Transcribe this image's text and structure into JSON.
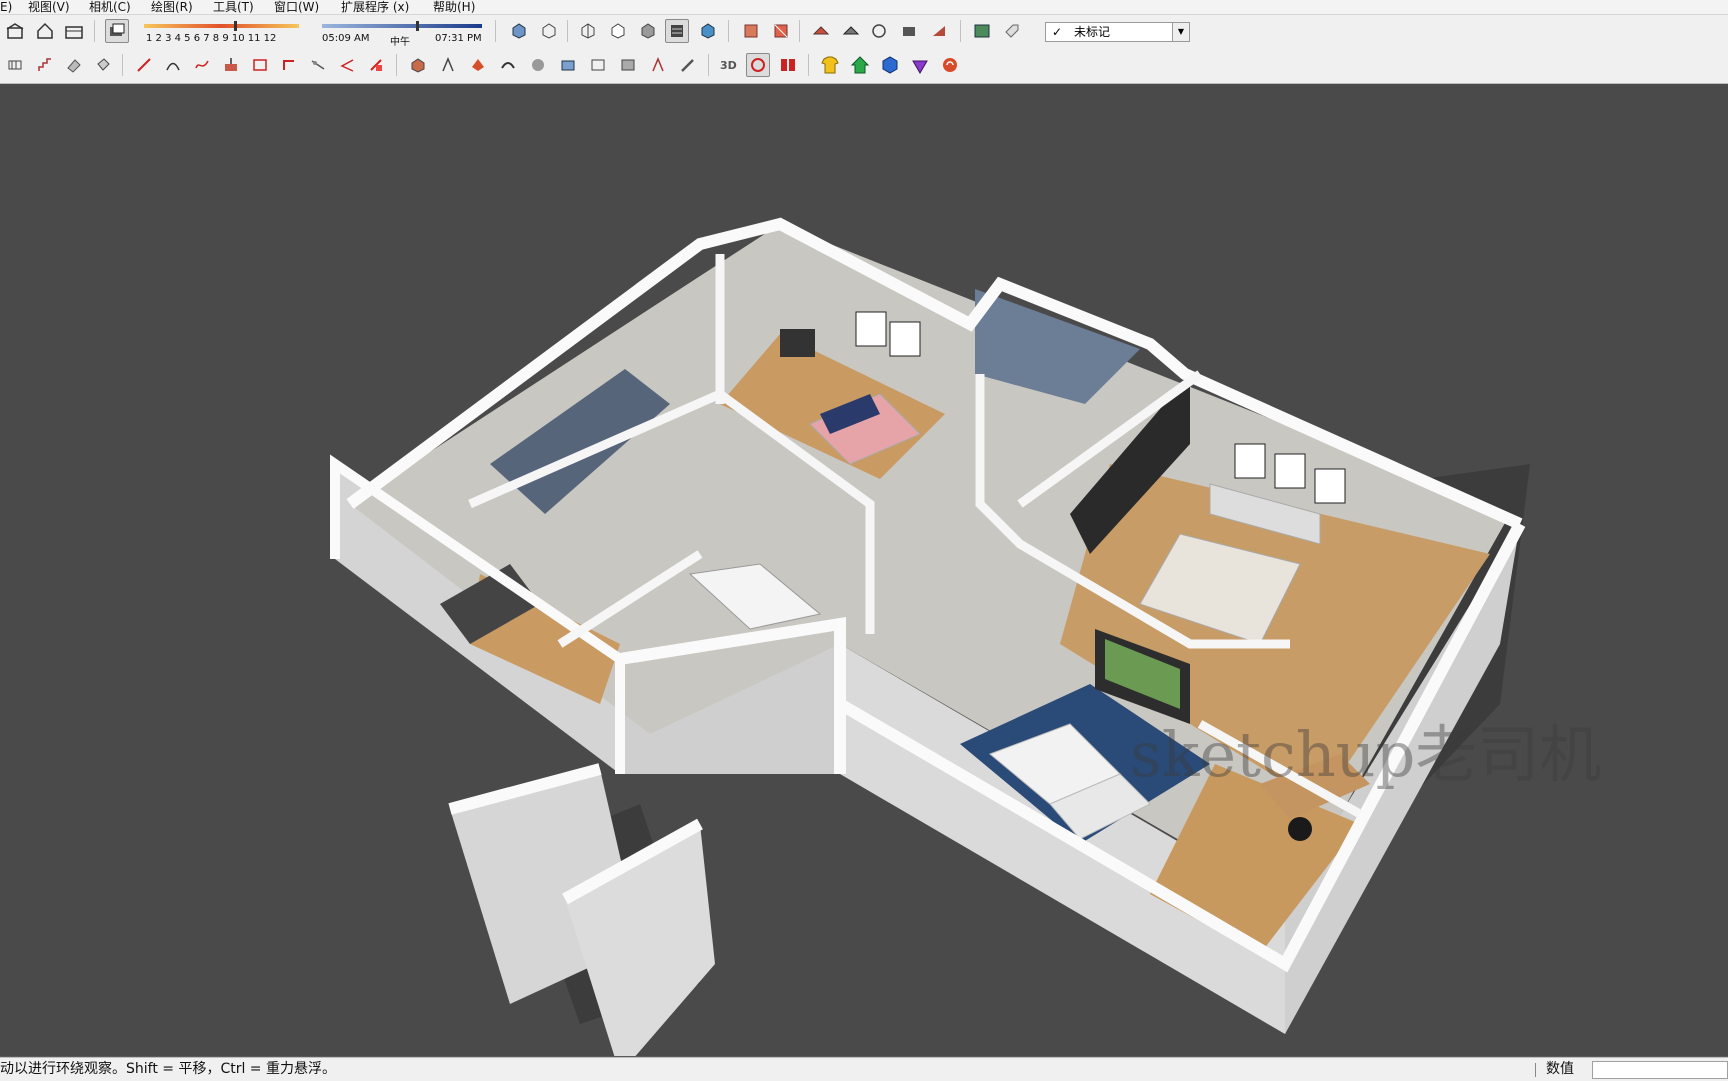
{
  "menu": [
    "E)",
    "视图(V)",
    "相机(C)",
    "绘图(R)",
    "工具(T)",
    "窗口(W)",
    "扩展程序 (x)",
    "帮助(H)"
  ],
  "shadow": {
    "months": "1 2 3 4 5 6 7 8 9 10 11 12",
    "sunrise": "05:09 AM",
    "noon": "中午",
    "sunset": "07:31 PM"
  },
  "layer": {
    "check": "✓",
    "name": "未标记"
  },
  "watermark": "sketchup老司机",
  "status": {
    "hint": "动以进行环绕观察。Shift = 平移，Ctrl = 重力悬浮。",
    "value_label": "数值"
  },
  "colors": {
    "viewport": "#4a4a4a",
    "wall": "#f2f2f2",
    "wall_side": "#d9d9d9",
    "floor": "#c8c6c0",
    "wood": "#c99a62",
    "rug": "#2a4a78"
  }
}
